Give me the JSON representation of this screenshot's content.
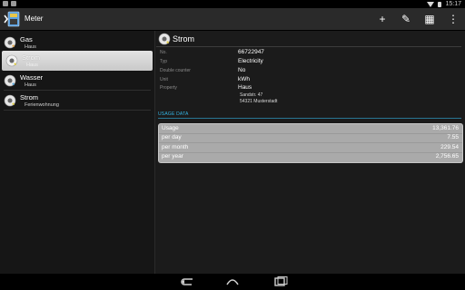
{
  "status_bar": {
    "time": "15:17"
  },
  "action_bar": {
    "title": "Meter",
    "actions": [
      {
        "icon": "add-icon",
        "glyph": "+"
      },
      {
        "icon": "edit-icon",
        "glyph": "✎"
      },
      {
        "icon": "calculator-icon",
        "glyph": "▦"
      },
      {
        "icon": "overflow-icon",
        "glyph": "⋮"
      }
    ]
  },
  "meters": [
    {
      "name": "Gas",
      "property": "Haus"
    },
    {
      "name": "Strom",
      "property": "Haus"
    },
    {
      "name": "Wasser",
      "property": "Haus"
    },
    {
      "name": "Strom",
      "property": "Ferienwohnung"
    }
  ],
  "selected_index": 1,
  "detail": {
    "title": "Strom",
    "props": [
      {
        "label": "No.",
        "value": "66722947"
      },
      {
        "label": "Typ",
        "value": "Electricity"
      },
      {
        "label": "Double counter",
        "value": "No"
      },
      {
        "label": "Unit",
        "value": "kWh"
      },
      {
        "label": "Property",
        "value": "Haus"
      }
    ],
    "address_line1": "Sandstr. 47",
    "address_line2": "54321 Musterstadt",
    "usage_heading": "USAGE DATA",
    "usage": [
      {
        "label": "Usage",
        "value": "13,361.76"
      },
      {
        "label": "per day",
        "value": "7.55"
      },
      {
        "label": "per month",
        "value": "229.54"
      },
      {
        "label": "per year",
        "value": "2,756.65"
      }
    ]
  },
  "colors": {
    "accent": "#33b5e5",
    "usage_box": "#aaaaaa"
  }
}
